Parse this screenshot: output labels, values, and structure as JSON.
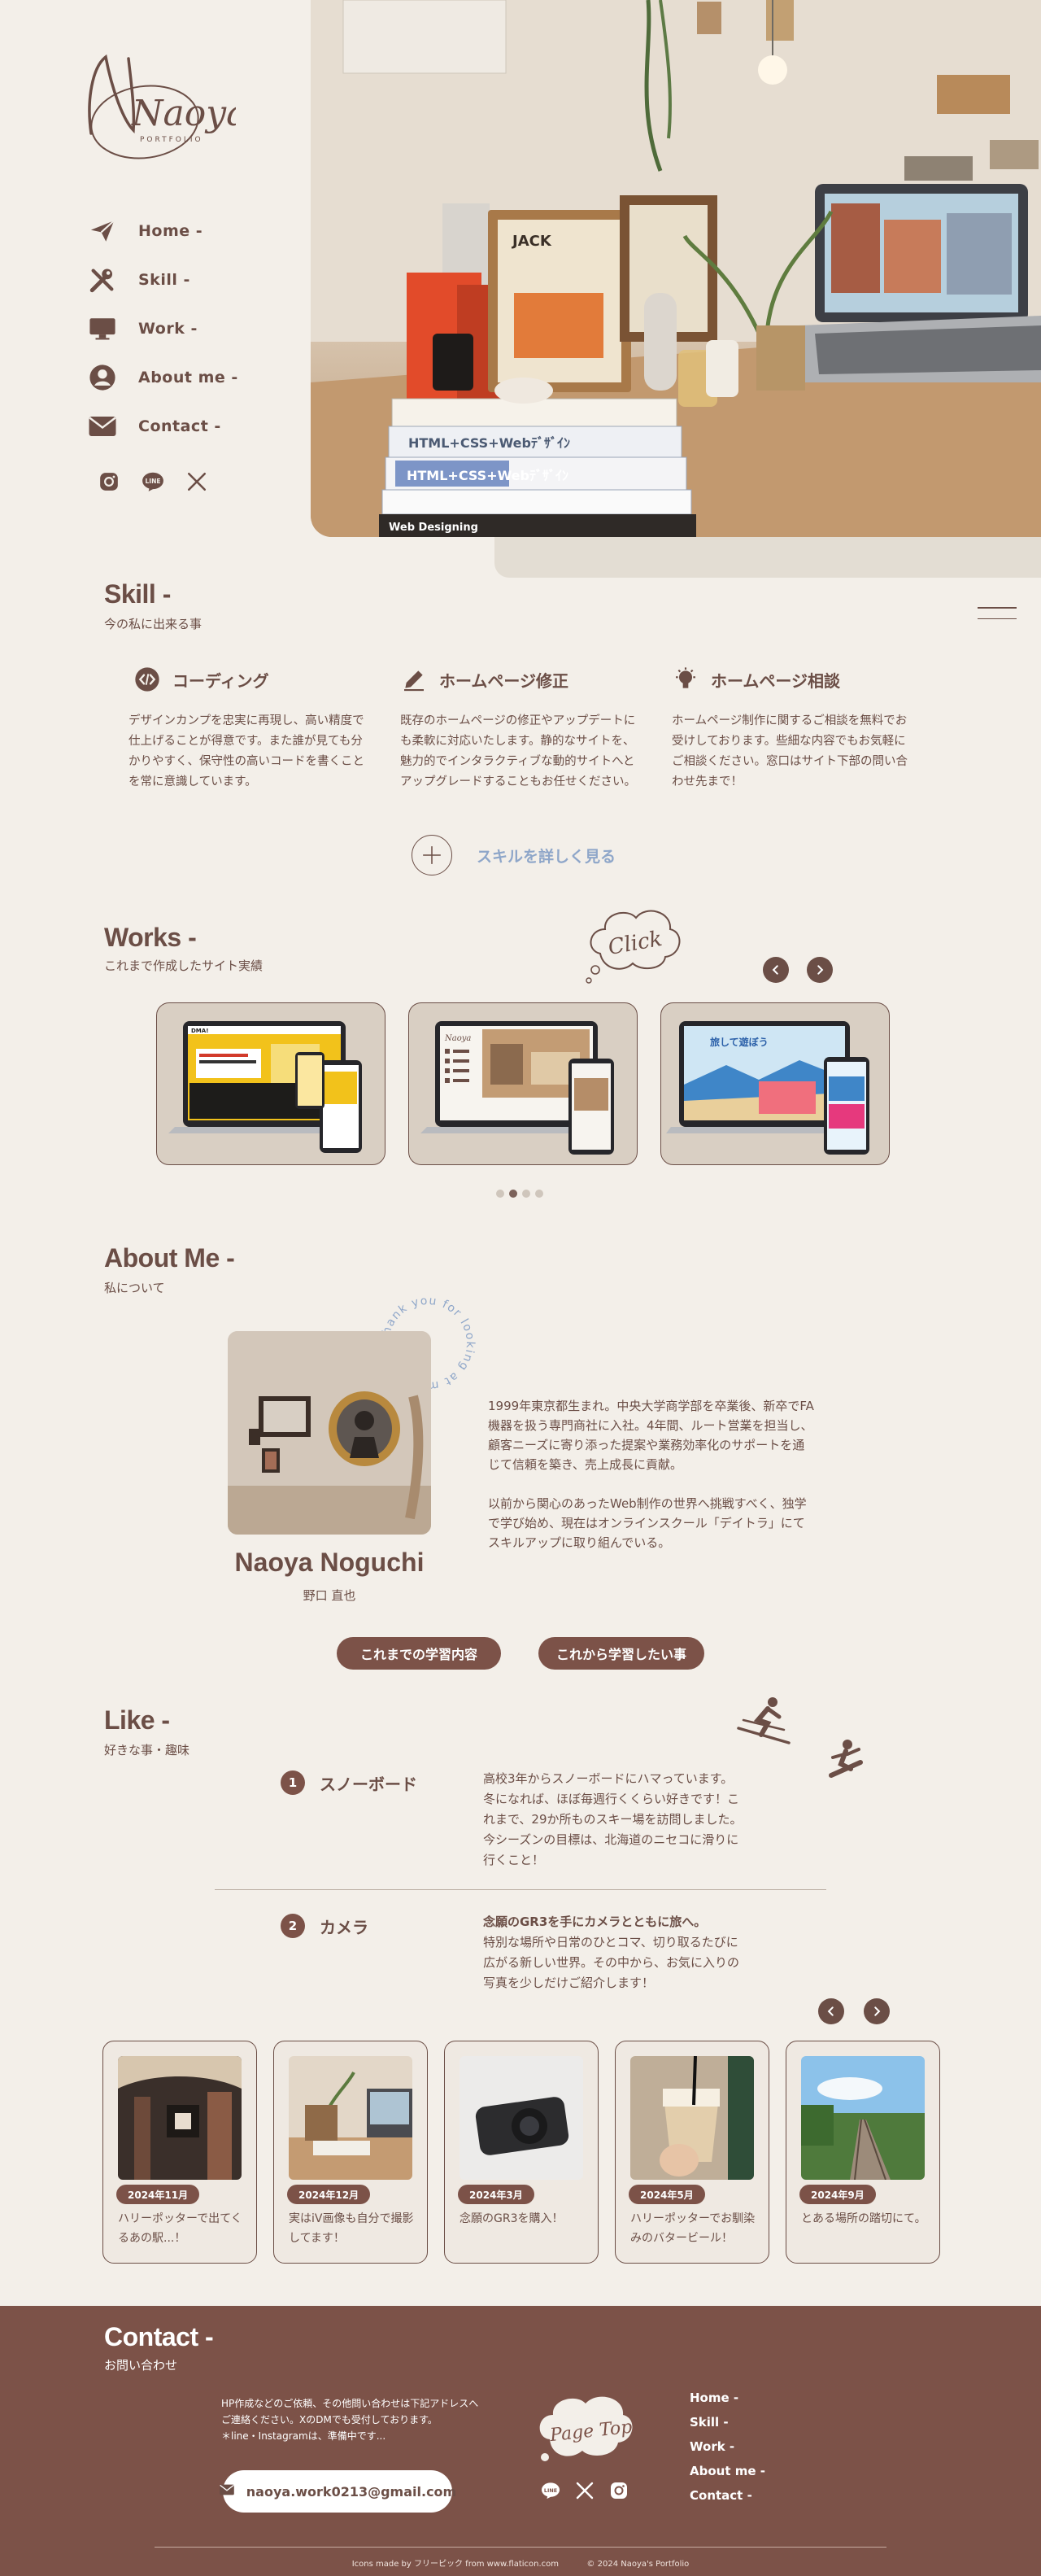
{
  "logo": {
    "text": "Naoya",
    "subtext": "PORTFOLIO"
  },
  "nav": {
    "items": [
      {
        "label": "Home -",
        "icon": "paper-plane-icon"
      },
      {
        "label": "Skill -",
        "icon": "tools-icon"
      },
      {
        "label": "Work -",
        "icon": "monitor-icon"
      },
      {
        "label": "About  me -",
        "icon": "user-icon"
      },
      {
        "label": "Contact -",
        "icon": "mail-icon"
      }
    ],
    "social": [
      "instagram-icon",
      "line-icon",
      "x-icon"
    ]
  },
  "hero": {
    "book_spines": [
      "HTML+CSS+Webﾃﾞｻﾞｲﾝ",
      "HTML+CSS+Webﾃﾞｻﾞｲﾝ",
      "Web Designing"
    ],
    "frame_text": "JACK"
  },
  "skill": {
    "title": "Skill -",
    "subtitle": "今の私に出来る事",
    "cards": [
      {
        "title": "コーディング",
        "icon": "code-icon",
        "body": "デザインカンプを忠実に再現し、高い精度で仕上げることが得意です。また誰が見ても分かりやすく、保守性の高いコードを書くことを常に意識しています。"
      },
      {
        "title": "ホームページ修正",
        "icon": "pencil-icon",
        "body": "既存のホームページの修正やアップデートにも柔軟に対応いたします。静的なサイトを、魅力的でインタラクティブな動的サイトへとアップグレードすることもお任せください。"
      },
      {
        "title": "ホームページ相談",
        "icon": "lightbulb-icon",
        "body": "ホームページ制作に関するご相談を無料でお受けしております。些細な内容でもお気軽にご相談ください。窓口はサイト下部の問い合わせ先まで！"
      }
    ],
    "more_label": "スキルを詳しく見る"
  },
  "works": {
    "title": "Works -",
    "subtitle": "これまで作成したサイト実績",
    "click_label": "Click",
    "cards": [
      {
        "name": "work-card-1",
        "bg": "#f2c21b",
        "headline": "DMA!"
      },
      {
        "name": "work-card-2",
        "bg": "#ffffff",
        "headline": "Naoya"
      },
      {
        "name": "work-card-3",
        "bg": "#cfe6f4",
        "headline": "旅して遊ぼう"
      }
    ],
    "active_dot": 1,
    "dot_count": 4
  },
  "about": {
    "title": "About Me -",
    "subtitle": "私について",
    "ring_text": "Thank you for looking at my portfolio!",
    "name": "Naoya Noguchi",
    "kana": "野口 直也",
    "paragraph1": "1999年東京都生まれ。中央大学商学部を卒業後、新卒でFA機器を扱う専門商社に入社。4年間、ルート営業を担当し、顧客ニーズに寄り添った提案や業務効率化のサポートを通じて信頼を築き、売上成長に貢献。",
    "paragraph2": "以前から関心のあったWeb制作の世界へ挑戦すべく、独学で学び始め、現在はオンラインスクール「デイトラ」にてスキルアップに取り組んでいる。",
    "button_past": "これまでの学習内容",
    "button_future": "これから学習したい事"
  },
  "like": {
    "title": "Like -",
    "subtitle": "好きな事・趣味",
    "items": [
      {
        "num": "1",
        "name": "スノーボード",
        "lines": [
          "高校3年からスノーボードにハマっています。",
          "冬になれば、ほぼ毎週行くくらい好きです！こ",
          "れまで、29か所ものスキー場を訪問しました。",
          "今シーズンの目標は、北海道のニセコに滑りに",
          "行くこと！"
        ]
      },
      {
        "num": "2",
        "name": "カメラ",
        "lead": "念願のGR3を手にカメラとともに旅へ。",
        "lines": [
          "特別な場所や日常のひとコマ、切り取るたびに",
          "広がる新しい世界。その中から、お気に入りの",
          "写真を少しだけご紹介します！"
        ]
      }
    ],
    "photos": [
      {
        "date": "2024年11月",
        "caption": "ハリーポッターで出てくるあの駅...！"
      },
      {
        "date": "2024年12月",
        "caption": "実はiV画像も自分で撮影してます！"
      },
      {
        "date": "2024年3月",
        "caption": "念願のGR3を購入！"
      },
      {
        "date": "2024年5月",
        "caption": "ハリーポッターでお馴染みのバタービール！"
      },
      {
        "date": "2024年9月",
        "caption": "とある場所の踏切にて。"
      }
    ]
  },
  "contact": {
    "title": "Contact -",
    "subtitle": "お問い合わせ",
    "text_lines": [
      "HP作成などのご依頼、その他問い合わせは下記アドレスへ",
      "ご連絡ください。XのDMでも受付しております。",
      "＊line・Instagramは、準備中です..."
    ],
    "email": "naoya.work0213@gmail.com",
    "page_top": "Page Top",
    "nav": [
      "Home -",
      "Skill -",
      "Work -",
      "About  me -",
      "Contact -"
    ],
    "credit": "Icons made by フリーピック  from www.flaticon.com",
    "copyright": "© 2024  Naoya's Portfolio"
  },
  "colors": {
    "background": "#f3efe9",
    "brand_brown": "#7c5248",
    "text_brown": "#6b4e46",
    "link_blue": "#8ea6c9"
  }
}
